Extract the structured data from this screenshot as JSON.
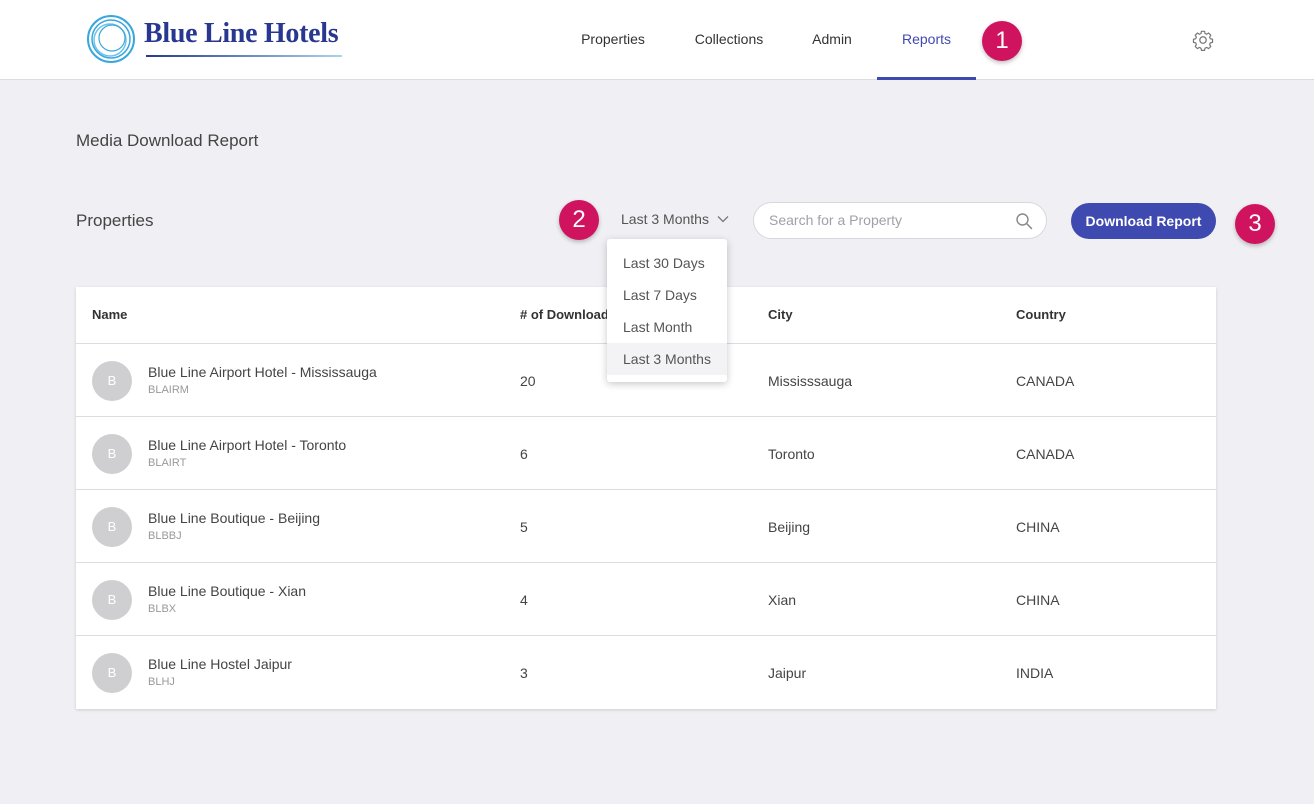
{
  "brand": {
    "name": "Blue Line Hotels"
  },
  "nav": {
    "items": [
      {
        "label": "Properties"
      },
      {
        "label": "Collections"
      },
      {
        "label": "Admin"
      },
      {
        "label": "Reports"
      }
    ],
    "active": "Reports"
  },
  "callouts": [
    "1",
    "2",
    "3"
  ],
  "page": {
    "title": "Media Download Report",
    "section_title": "Properties"
  },
  "filters": {
    "range_selected": "Last 3 Months",
    "range_options": [
      "Last 30 Days",
      "Last 7 Days",
      "Last Month",
      "Last 3 Months"
    ],
    "search_placeholder": "Search for a Property",
    "download_label": "Download Report"
  },
  "table": {
    "headers": {
      "name": "Name",
      "downloads": "# of Downloads",
      "city": "City",
      "country": "Country"
    },
    "rows": [
      {
        "initial": "B",
        "name": "Blue Line Airport Hotel - Mississauga",
        "code": "BLAIRM",
        "downloads": "20",
        "city": "Mississsauga",
        "country": "CANADA"
      },
      {
        "initial": "B",
        "name": "Blue Line Airport Hotel - Toronto",
        "code": "BLAIRT",
        "downloads": "6",
        "city": "Toronto",
        "country": "CANADA"
      },
      {
        "initial": "B",
        "name": "Blue Line Boutique - Beijing",
        "code": "BLBBJ",
        "downloads": "5",
        "city": "Beijing",
        "country": "CHINA"
      },
      {
        "initial": "B",
        "name": "Blue Line Boutique - Xian",
        "code": "BLBX",
        "downloads": "4",
        "city": "Xian",
        "country": "CHINA"
      },
      {
        "initial": "B",
        "name": "Blue Line Hostel Jaipur",
        "code": "BLHJ",
        "downloads": "3",
        "city": "Jaipur",
        "country": "INDIA"
      }
    ]
  },
  "colors": {
    "accent": "#3f4ab0",
    "brand": "#283891",
    "callout": "#d0135f",
    "background": "#f0f0f4"
  },
  "icons": [
    "logo-rings-icon",
    "gear-icon",
    "chevron-down-icon",
    "search-icon"
  ]
}
